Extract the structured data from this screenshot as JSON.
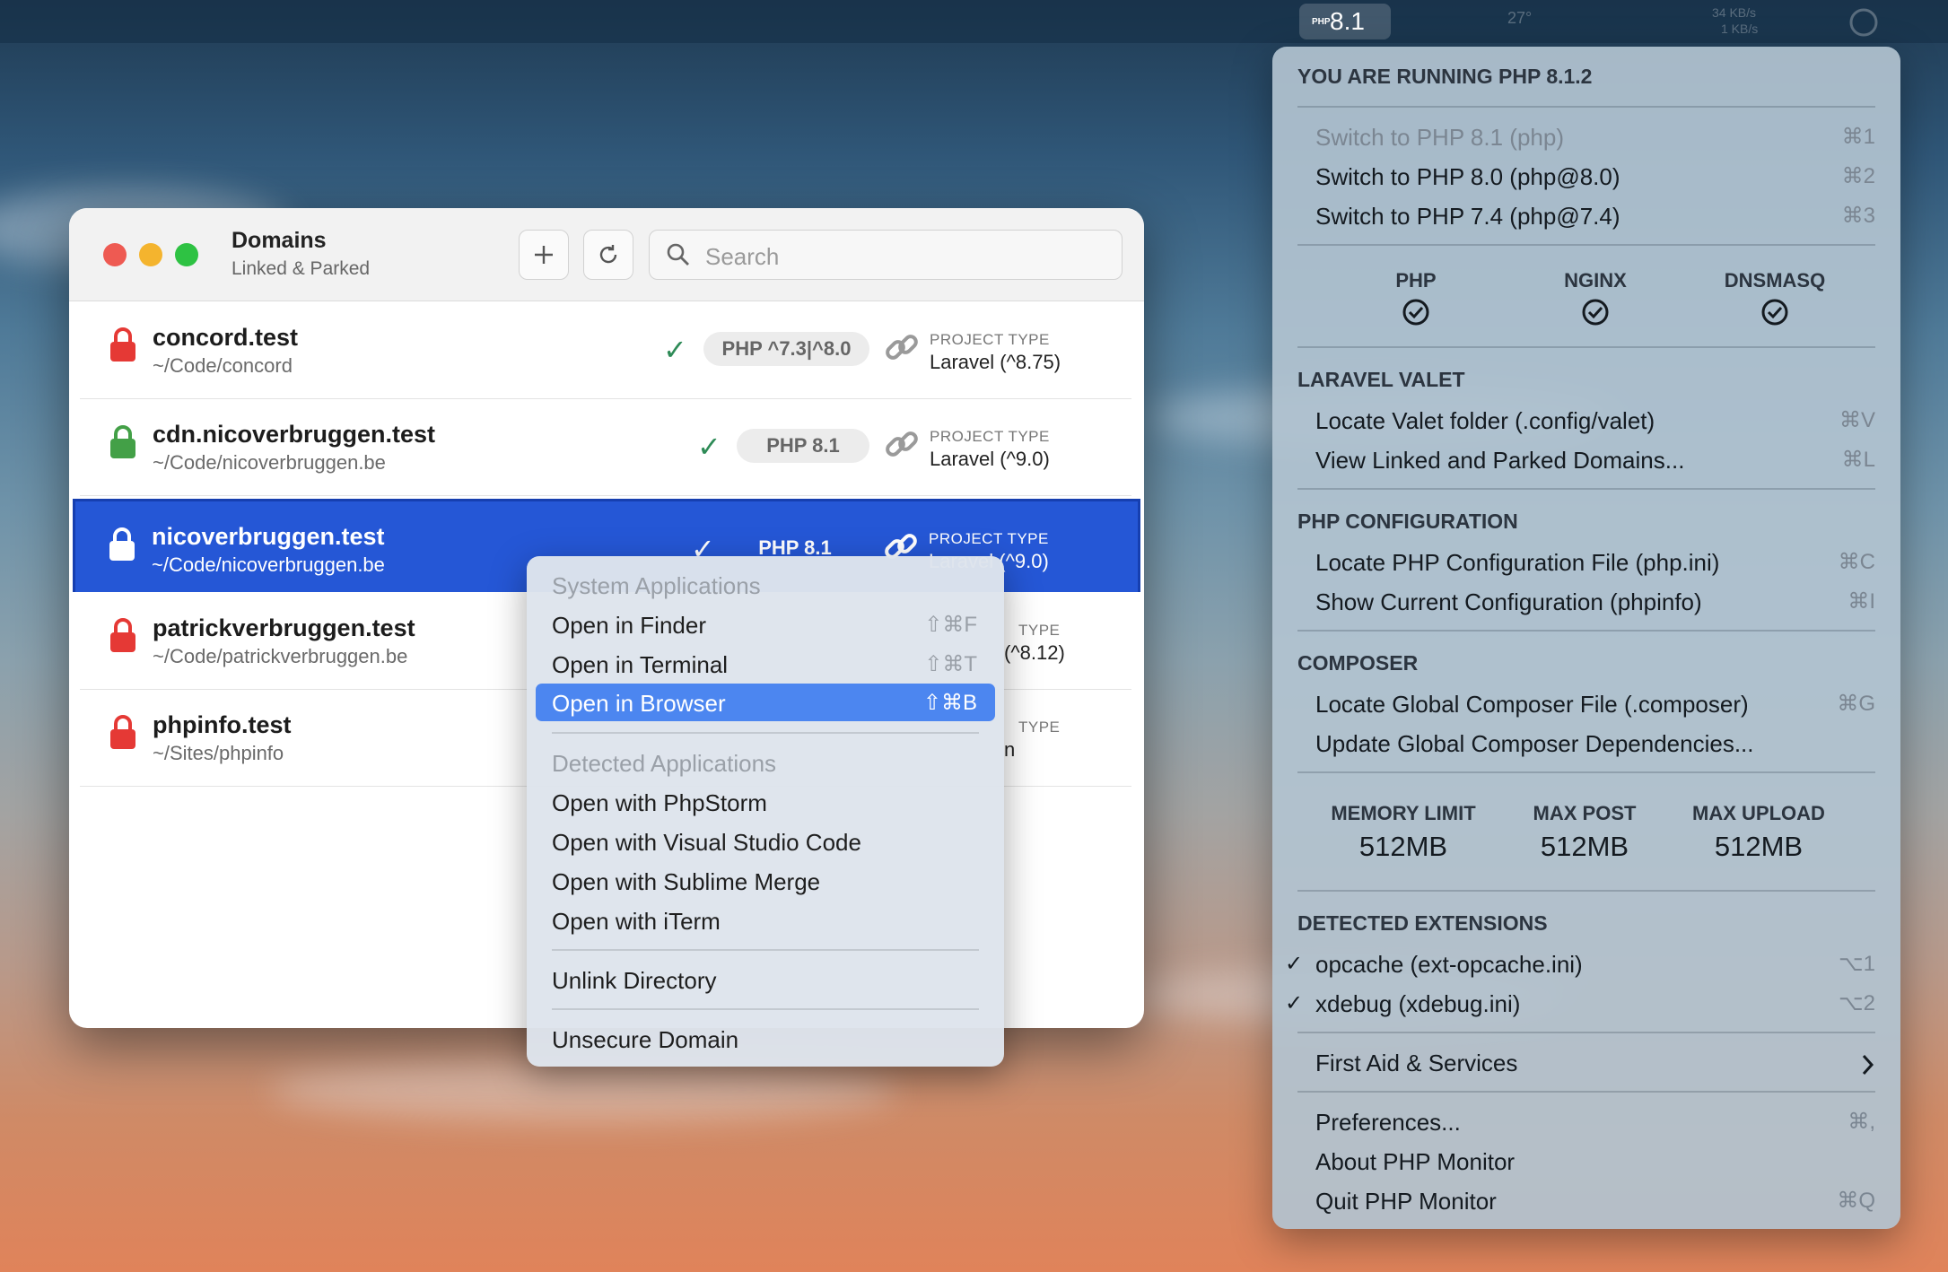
{
  "menubar": {
    "php_badge_mini": "PHP",
    "php_version": "8.1",
    "faint_items": [
      "27°",
      "34 KB/s",
      "1 KB/s"
    ]
  },
  "window": {
    "title": "Domains",
    "subtitle": "Linked & Parked",
    "search_placeholder": "Search",
    "rows": [
      {
        "name": "concord.test",
        "path": "~/Code/concord",
        "secure": false,
        "php": "PHP ^7.3|^8.0",
        "project_type_label": "PROJECT TYPE",
        "project_type": "Laravel (^8.75)"
      },
      {
        "name": "cdn.nicoverbruggen.test",
        "path": "~/Code/nicoverbruggen.be",
        "secure": true,
        "php": "PHP 8.1",
        "project_type_label": "PROJECT TYPE",
        "project_type": "Laravel (^9.0)"
      },
      {
        "name": "nicoverbruggen.test",
        "path": "~/Code/nicoverbruggen.be",
        "secure": true,
        "php": "PHP 8.1",
        "project_type_label": "PROJECT TYPE",
        "project_type": "Laravel (^9.0)"
      },
      {
        "name": "patrickverbruggen.test",
        "path": "~/Code/patrickverbruggen.be",
        "secure": false,
        "php": "",
        "project_type_label": "TYPE",
        "project_type": "(^8.12)"
      },
      {
        "name": "phpinfo.test",
        "path": "~/Sites/phpinfo",
        "secure": false,
        "php": "",
        "project_type_label": "TYPE",
        "project_type": "n"
      }
    ]
  },
  "context_menu": {
    "system_header": "System Applications",
    "open_finder": "Open in Finder",
    "open_finder_sc": "⇧⌘F",
    "open_terminal": "Open in Terminal",
    "open_terminal_sc": "⇧⌘T",
    "open_browser": "Open in Browser",
    "open_browser_sc": "⇧⌘B",
    "detected_header": "Detected Applications",
    "phpstorm": "Open with PhpStorm",
    "vscode": "Open with Visual Studio Code",
    "sublime_merge": "Open with Sublime Merge",
    "iterm": "Open with iTerm",
    "unlink": "Unlink Directory",
    "unsecure": "Unsecure Domain"
  },
  "php_monitor": {
    "running": "YOU ARE RUNNING PHP 8.1.2",
    "switch_81": "Switch to PHP 8.1 (php)",
    "switch_81_sc": "⌘1",
    "switch_80": "Switch to PHP 8.0 (php@8.0)",
    "switch_80_sc": "⌘2",
    "switch_74": "Switch to PHP 7.4 (php@7.4)",
    "switch_74_sc": "⌘3",
    "services": [
      "PHP",
      "NGINX",
      "DNSMASQ"
    ],
    "valet_header": "LARAVEL VALET",
    "locate_valet": "Locate Valet folder (.config/valet)",
    "locate_valet_sc": "⌘V",
    "view_domains": "View Linked and Parked Domains...",
    "view_domains_sc": "⌘L",
    "php_config_header": "PHP CONFIGURATION",
    "locate_ini": "Locate PHP Configuration File (php.ini)",
    "locate_ini_sc": "⌘C",
    "phpinfo": "Show Current Configuration (phpinfo)",
    "phpinfo_sc": "⌘I",
    "composer_header": "COMPOSER",
    "locate_composer": "Locate Global Composer File (.composer)",
    "locate_composer_sc": "⌘G",
    "update_composer": "Update Global Composer Dependencies...",
    "limits": [
      {
        "label": "MEMORY LIMIT",
        "value": "512MB"
      },
      {
        "label": "MAX POST",
        "value": "512MB"
      },
      {
        "label": "MAX UPLOAD",
        "value": "512MB"
      }
    ],
    "extensions_header": "DETECTED EXTENSIONS",
    "ext_opcache": "opcache (ext-opcache.ini)",
    "ext_opcache_sc": "⌥1",
    "ext_xdebug": "xdebug (xdebug.ini)",
    "ext_xdebug_sc": "⌥2",
    "first_aid": "First Aid & Services",
    "preferences": "Preferences...",
    "preferences_sc": "⌘,",
    "about": "About PHP Monitor",
    "quit": "Quit PHP Monitor",
    "quit_sc": "⌘Q"
  },
  "colors": {
    "lock_insecure": "#e53935",
    "lock_secure": "#43a047",
    "selection": "#2557d6",
    "menu_highlight": "#4c86f0"
  }
}
